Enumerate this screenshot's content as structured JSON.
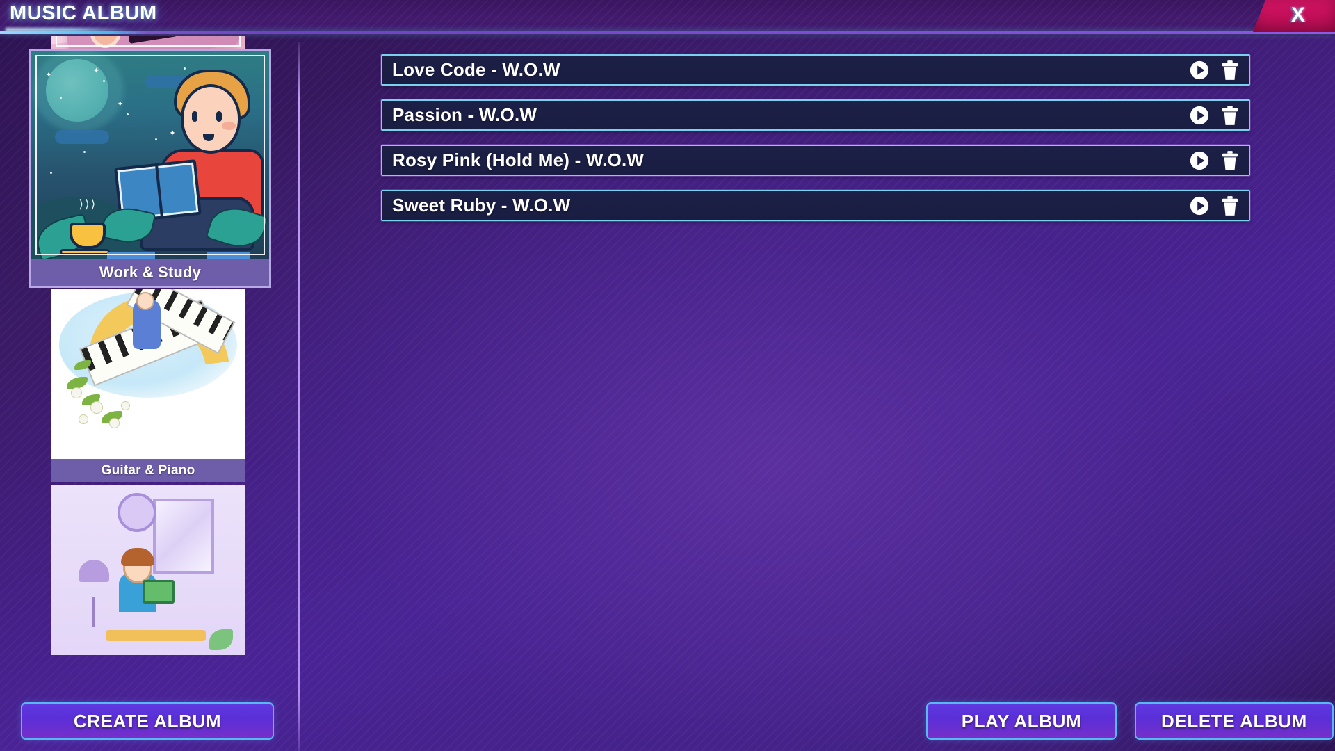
{
  "window": {
    "title": "MUSIC ALBUM",
    "title_dots": "...",
    "close_label": "X",
    "close_icon": "close-x-icon",
    "accent_cyan": "#7ad0ef",
    "accent_purple": "#5a2fd8",
    "close_pink": "#c20f58",
    "row_bg": "#1d2046",
    "label_bar": "#6e5eaa"
  },
  "sidebar": {
    "albums": [
      {
        "label": "",
        "art": "cassette",
        "selected": false,
        "partial": "top"
      },
      {
        "label": "Work & Study",
        "art": "night-reading",
        "selected": true,
        "partial": "none"
      },
      {
        "label": "Guitar & Piano",
        "art": "piano-moon",
        "selected": false,
        "partial": "none"
      },
      {
        "label": "",
        "art": "room-reading",
        "selected": false,
        "partial": "bottom"
      }
    ]
  },
  "songs": {
    "play_icon": "play-icon",
    "delete_icon": "trash-icon",
    "items": [
      {
        "title": "Love Code - W.O.W"
      },
      {
        "title": "Passion - W.O.W"
      },
      {
        "title": "Rosy Pink (Hold Me) - W.O.W"
      },
      {
        "title": "Sweet Ruby - W.O.W"
      }
    ]
  },
  "footer": {
    "create_album": "CREATE ALBUM",
    "play_album": "PLAY ALBUM",
    "delete_album": "DELETE ALBUM"
  }
}
